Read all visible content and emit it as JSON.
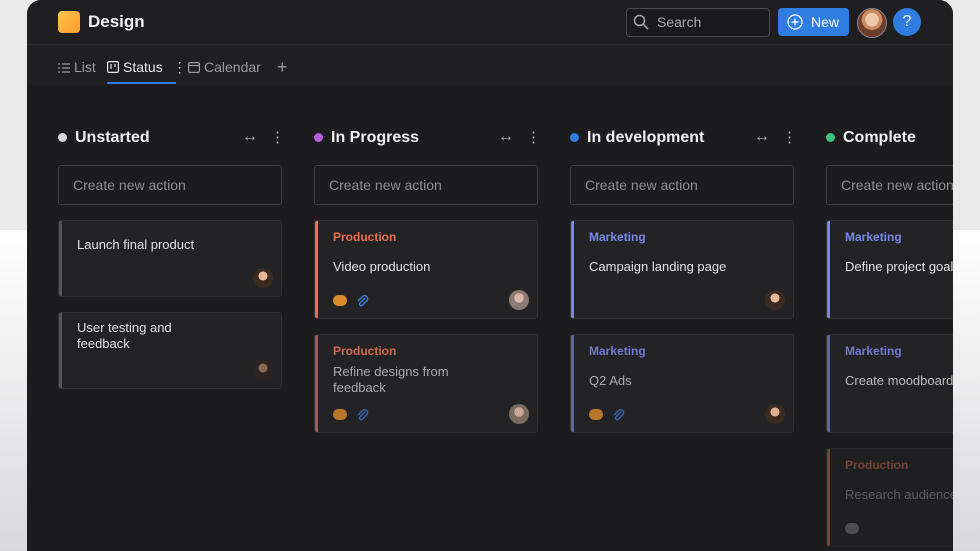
{
  "app": {
    "title": "Design"
  },
  "header": {
    "search_placeholder": "Search",
    "new_label": "New",
    "help_label": "?"
  },
  "tabs": [
    {
      "label": "List",
      "icon": "list-icon"
    },
    {
      "label": "Status",
      "icon": "board-icon",
      "active": true
    },
    {
      "label": "Calendar",
      "icon": "calendar-icon"
    }
  ],
  "colors": {
    "accent": "#2f7de1",
    "production": "#e8704f",
    "marketing": "#7b86e8"
  },
  "columns": [
    {
      "title": "Unstarted",
      "dot": "#d9d9dc",
      "create_placeholder": "Create new action",
      "cards": [
        {
          "title": "Launch final product"
        },
        {
          "title": "User testing and feedback"
        }
      ]
    },
    {
      "title": "In Progress",
      "dot": "#b45ee0",
      "create_placeholder": "Create new action",
      "cards": [
        {
          "tag": "Production",
          "title": "Video production"
        },
        {
          "tag": "Production",
          "title": "Refine designs from feedback"
        }
      ]
    },
    {
      "title": "In development",
      "dot": "#2f7de1",
      "create_placeholder": "Create new action",
      "cards": [
        {
          "tag": "Marketing",
          "title": "Campaign landing page"
        },
        {
          "tag": "Marketing",
          "title": "Q2 Ads"
        }
      ]
    },
    {
      "title": "Complete",
      "dot": "#3cc47c",
      "create_placeholder": "Create new action",
      "cards": [
        {
          "tag": "Marketing",
          "title": "Define project goals"
        },
        {
          "tag": "Marketing",
          "title": "Create moodboard"
        },
        {
          "tag": "Production",
          "title": "Research audience"
        }
      ]
    }
  ]
}
